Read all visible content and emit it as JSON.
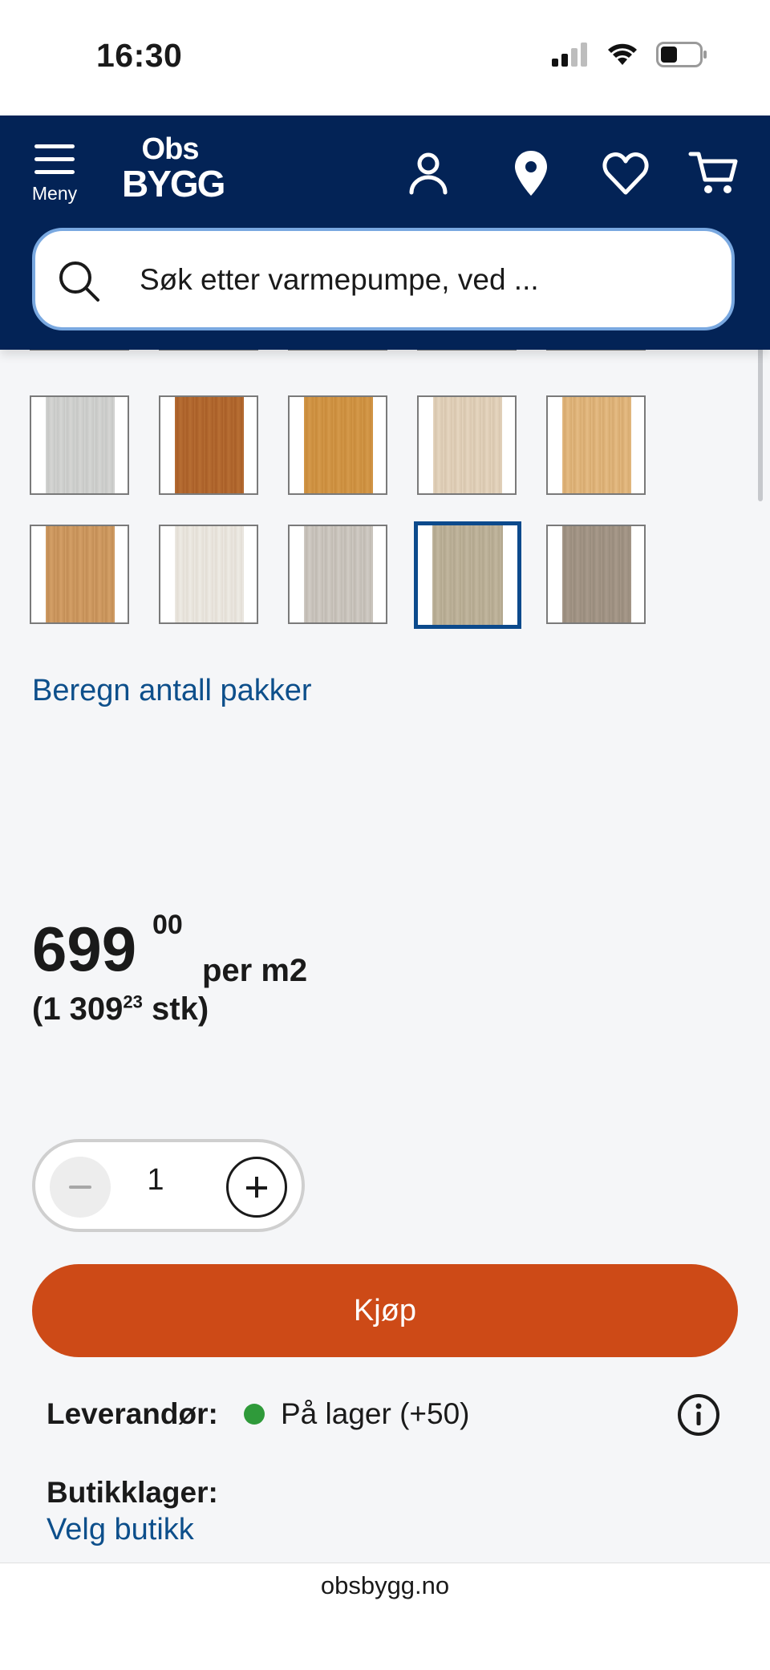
{
  "status_bar": {
    "time": "16:30"
  },
  "header": {
    "menu_label": "Meny",
    "logo_top": "Obs",
    "logo_bottom": "BYGG",
    "search_placeholder": "Søk etter varmepumpe, ved ..."
  },
  "swatches": {
    "selected_index": 13,
    "items": [
      {
        "color_a": "#ad6a3f",
        "color_b": "#9b5a32"
      },
      {
        "color_a": "#a0785c",
        "color_b": "#8d6b52"
      },
      {
        "color_a": "#d2a15f",
        "color_b": "#c0914f"
      },
      {
        "color_a": "#8f8d8a",
        "color_b": "#a09e9a"
      },
      {
        "color_a": "#8a857f",
        "color_b": "#99948d"
      },
      {
        "color_a": "#d5d6d4",
        "color_b": "#c6c7c5"
      },
      {
        "color_a": "#b86f34",
        "color_b": "#a85e27"
      },
      {
        "color_a": "#d59a4b",
        "color_b": "#c88a3a"
      },
      {
        "color_a": "#e6d6c0",
        "color_b": "#d7c5ad"
      },
      {
        "color_a": "#e5bc84",
        "color_b": "#d6a96e"
      },
      {
        "color_a": "#d4a067",
        "color_b": "#c28d55"
      },
      {
        "color_a": "#eeebe5",
        "color_b": "#e2ddd4"
      },
      {
        "color_a": "#d1ccc5",
        "color_b": "#bfb9b1"
      },
      {
        "color_a": "#c2b79f",
        "color_b": "#b1a68d"
      },
      {
        "color_a": "#a89a8b",
        "color_b": "#978a7b"
      }
    ]
  },
  "calc_link": "Beregn antall pakker",
  "price": {
    "main": "699",
    "decimals": "00",
    "unit": "per m2",
    "stk_open": "(1 309",
    "stk_decimals": "23",
    "stk_close": " stk)"
  },
  "quantity": {
    "value": "1"
  },
  "buy_button": "Kjøp",
  "supplier": {
    "label": "Leverandør:",
    "status": "På lager (+50)",
    "status_color": "#2f9a3a"
  },
  "store": {
    "label": "Butikklager:",
    "link": "Velg butikk"
  },
  "footer_url": "obsbygg.no"
}
